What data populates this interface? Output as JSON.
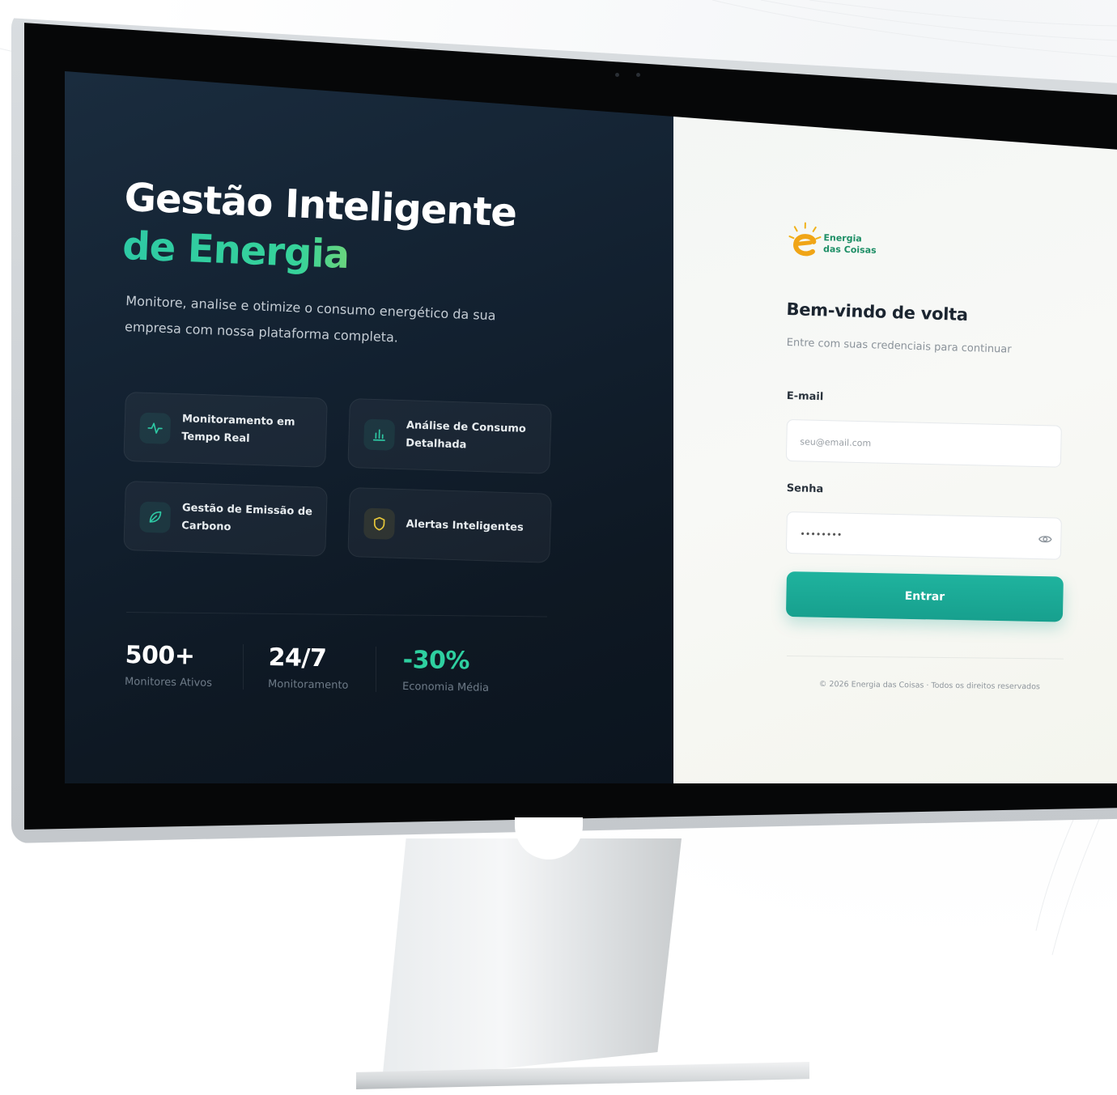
{
  "hero": {
    "title_line1": "Gestão Inteligente",
    "title_line2": "de Energia",
    "subtitle": "Monitore, analise e otimize o consumo energético da sua empresa com nossa plataforma completa."
  },
  "features": [
    {
      "label": "Monitoramento em Tempo Real",
      "icon": "activity-icon"
    },
    {
      "label": "Análise de Consumo Detalhada",
      "icon": "bar-chart-icon"
    },
    {
      "label": "Gestão de Emissão de Carbono",
      "icon": "leaf-icon"
    },
    {
      "label": "Alertas Inteligentes",
      "icon": "shield-icon"
    }
  ],
  "stats": [
    {
      "value": "500+",
      "label": "Monitores Ativos"
    },
    {
      "value": "24/7",
      "label": "Monitoramento"
    },
    {
      "value": "-30%",
      "label": "Economia Média"
    }
  ],
  "brand": {
    "name_line1": "Energia",
    "name_line2": "das Coisas",
    "logo_icon": "sun-e-logo-icon"
  },
  "login": {
    "title": "Bem-vindo de volta",
    "subtitle": "Entre com suas credenciais para continuar",
    "email_label": "E-mail",
    "email_placeholder": "seu@email.com",
    "password_label": "Senha",
    "password_value": "••••••••",
    "submit_label": "Entrar"
  },
  "footer": {
    "text": "© 2026 Energia das Coisas · Todos os direitos reservados"
  },
  "colors": {
    "accent_teal": "#1fb39e",
    "stat_green": "#2ed0a0",
    "gradient_yellow": "#e8c83a",
    "panel_dark": "#12202f"
  }
}
